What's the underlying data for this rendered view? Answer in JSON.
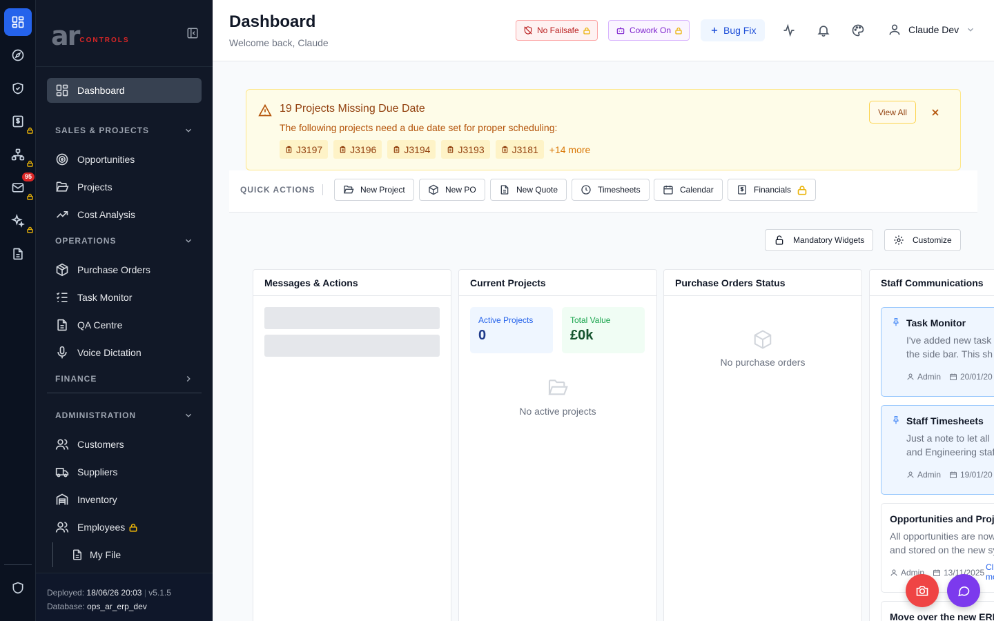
{
  "rail": {
    "icons": [
      "dashboard-icon",
      "compass-icon",
      "shield-check-icon",
      "dollar-doc-icon",
      "network-icon",
      "mail-icon",
      "sparkles-icon",
      "document-icon",
      "shield-icon"
    ],
    "mail_badge": "95"
  },
  "sidebar": {
    "logo_main": "ar",
    "logo_sub": "CONTROLS",
    "dashboard": "Dashboard",
    "sections": {
      "sales": "SALES & PROJECTS",
      "operations": "OPERATIONS",
      "finance": "FINANCE",
      "administration": "ADMINISTRATION"
    },
    "sales_items": [
      "Opportunities",
      "Projects",
      "Cost Analysis"
    ],
    "operations_items": [
      "Purchase Orders",
      "Task Monitor",
      "QA Centre",
      "Voice Dictation"
    ],
    "admin_items": [
      "Customers",
      "Suppliers",
      "Inventory",
      "Employees"
    ],
    "sub_item": "My File",
    "footer": {
      "deployed_label": "Deployed:",
      "deployed_value": "18/06/26 20:03",
      "separator": "|",
      "version": "v5.1.5",
      "database_label": "Database:",
      "database_value": "ops_ar_erp_dev"
    }
  },
  "header": {
    "title": "Dashboard",
    "subtitle": "Welcome back, Claude",
    "failsafe": "No Failsafe",
    "cowork": "Cowork On",
    "bugfix": "Bug Fix",
    "user": "Claude Dev"
  },
  "alert": {
    "title": "19 Projects Missing Due Date",
    "message": "The following projects need a due date set for proper scheduling:",
    "chips": [
      "J3197",
      "J3196",
      "J3194",
      "J3193",
      "J3181"
    ],
    "more": "+14 more",
    "view_all": "View All"
  },
  "quick_actions": {
    "label": "QUICK ACTIONS",
    "buttons": [
      "New Project",
      "New PO",
      "New Quote",
      "Timesheets",
      "Calendar",
      "Financials"
    ]
  },
  "toolbar": {
    "mandatory": "Mandatory Widgets",
    "customize": "Customize"
  },
  "widgets": {
    "messages": {
      "title": "Messages & Actions"
    },
    "projects": {
      "title": "Current Projects",
      "active_label": "Active Projects",
      "active_value": "0",
      "value_label": "Total Value",
      "value_value": "£0k",
      "empty": "No active projects"
    },
    "po": {
      "title": "Purchase Orders Status",
      "empty": "No purchase orders"
    },
    "staff": {
      "title": "Staff Communications",
      "posts": [
        {
          "title": "Task Monitor",
          "line1": "I've added new task",
          "line2": "the side bar. This sh",
          "author": "Admin",
          "date": "20/01/20"
        },
        {
          "title": "Staff Timesheets",
          "line1": "Just a note to let all",
          "line2": "and Engineering staf",
          "author": "Admin",
          "date": "19/01/20"
        },
        {
          "title": "Opportunities and Proj",
          "line1": "All opportunities are now",
          "line2": "and stored on the new sy",
          "author": "Admin",
          "date": "13/11/2025",
          "more1": "Cli",
          "more2": "mo"
        },
        {
          "title": "Move over the new ERI"
        }
      ]
    }
  },
  "colors": {
    "rail_bg": "#0b1220",
    "sidebar_bg": "#111827",
    "accent": "#2563eb",
    "alert_bg": "#fefce8",
    "lock": "#eab308",
    "fab_camera": "#ef4444",
    "fab_chat": "#7c3aed"
  }
}
